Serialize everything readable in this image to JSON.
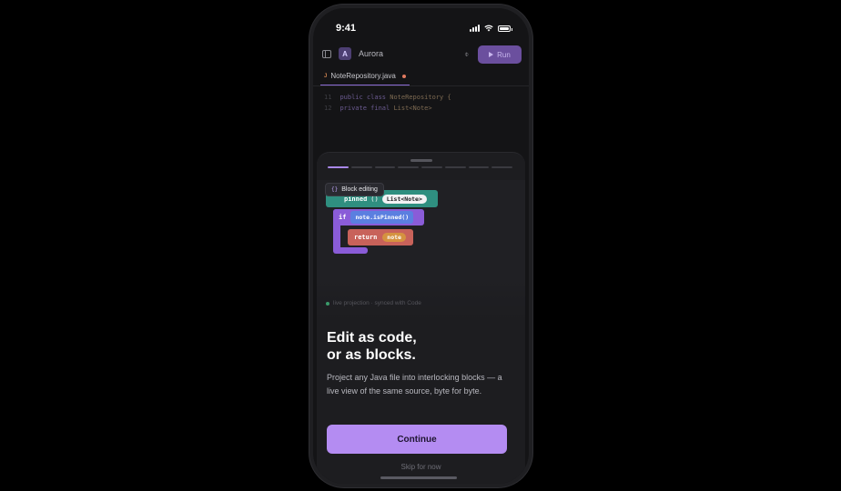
{
  "status_bar": {
    "time": "9:41"
  },
  "ide": {
    "project_initial": "A",
    "project_name": "Aurora",
    "run_label": "Run",
    "tab_icon": "J",
    "tab_name": "NoteRepository.java",
    "code_lines": [
      {
        "number": "11",
        "keyword": "public class",
        "name": "NoteRepository {"
      },
      {
        "number": "12",
        "keyword": "private final",
        "name": "List<Note>"
      }
    ]
  },
  "onboarding": {
    "step_total": 8,
    "step_current": 1,
    "badge_icon": "{}",
    "badge_label": "Block editing",
    "blocks": {
      "pinned_keyword": "pinned",
      "pinned_parens": "()",
      "pinned_type": "List<Note>",
      "if_keyword": "if",
      "if_condition": "note.isPinned()",
      "return_keyword": "return",
      "return_value": "note"
    },
    "live_note": "live projection · synced with Code",
    "headline_line1": "Edit as code,",
    "headline_line2": "or as blocks.",
    "body": "Project any Java file into interlocking blocks — a live view of the same source, byte for byte.",
    "continue_label": "Continue",
    "skip_label": "Skip for now"
  },
  "colors": {
    "accent": "#b48cf2",
    "block_teal": "#2f8f80",
    "block_purple": "#8a5cd8",
    "block_blue": "#5b7fe0",
    "block_red": "#c8625a",
    "block_orange": "#d59240"
  },
  "icons": [
    "cellular-signal-icon",
    "wifi-icon",
    "battery-icon",
    "sidebar-toggle-icon",
    "branch-icon",
    "play-icon",
    "java-file-icon"
  ]
}
